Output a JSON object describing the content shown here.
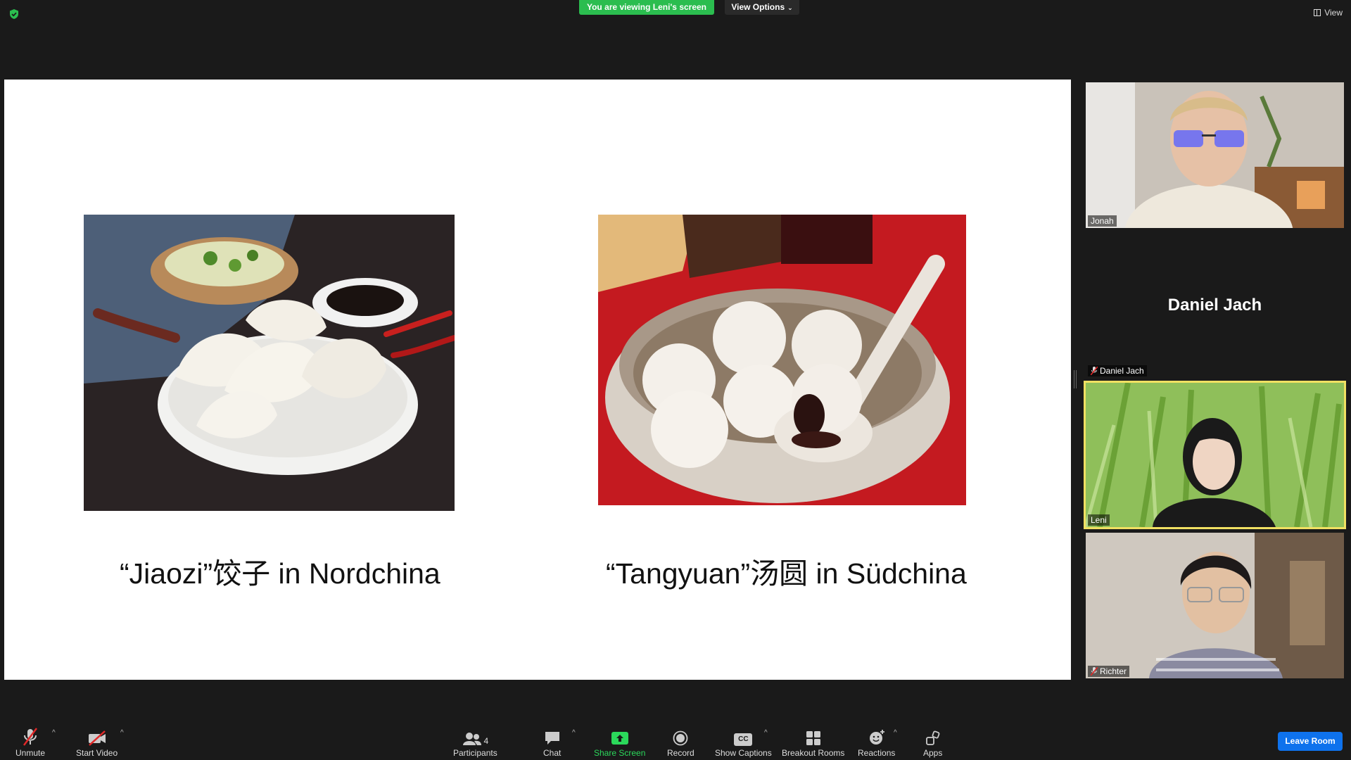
{
  "top_bar": {
    "viewing_banner": "You are viewing Leni's screen",
    "view_options": "View Options",
    "view_button": "View"
  },
  "slide": {
    "left_caption": "“Jiaozi”饺子  in Nordchina",
    "right_caption": "“Tangyuan”汤圆  in Südchina"
  },
  "participants": [
    {
      "name": "Jonah",
      "muted": false
    },
    {
      "name": "Daniel Jach",
      "muted": true,
      "display_name": "Daniel Jach"
    },
    {
      "name": "Leni",
      "muted": false,
      "speaking": true
    },
    {
      "name": "Richter",
      "muted": true
    }
  ],
  "toolbar": {
    "unmute": "Unmute",
    "start_video": "Start Video",
    "participants": "Participants",
    "participants_count": "4",
    "chat": "Chat",
    "share_screen": "Share Screen",
    "record": "Record",
    "show_captions": "Show Captions",
    "captions_icon_text": "CC",
    "breakout_rooms": "Breakout Rooms",
    "reactions": "Reactions",
    "apps": "Apps",
    "leave_room": "Leave Room"
  },
  "colors": {
    "banner_green": "#2bbd4f",
    "active_speaker_border": "#f0e062",
    "leave_blue": "#0e72ed",
    "share_green": "#2bd85b"
  }
}
